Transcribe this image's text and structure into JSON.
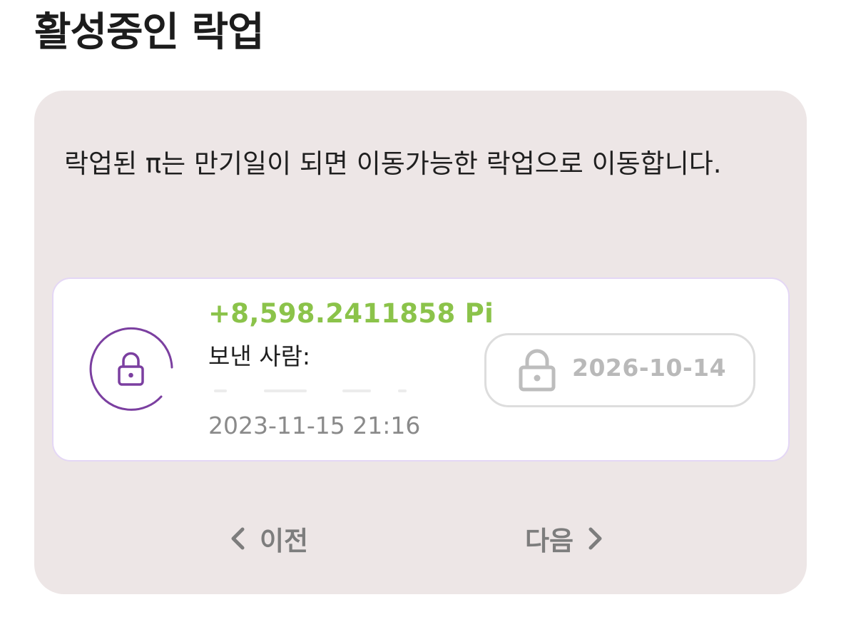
{
  "header": {
    "title": "활성중인 락업"
  },
  "panel": {
    "info_text": "락업된 π는 만기일이 되면 이동가능한 락업으로 이동합니다."
  },
  "lockup": {
    "amount": "+8,598.2411858 Pi",
    "sender_label": "보낸 사람:",
    "locked_at": "2023-11-15 21:16",
    "unlock_date": "2026-10-14",
    "lock_icon": "lock-icon",
    "accent_color": "#7b3fa0",
    "amount_color": "#8bc34a"
  },
  "pagination": {
    "prev_label": "이전",
    "next_label": "다음",
    "prev_icon": "chevron-left-icon",
    "next_icon": "chevron-right-icon"
  }
}
